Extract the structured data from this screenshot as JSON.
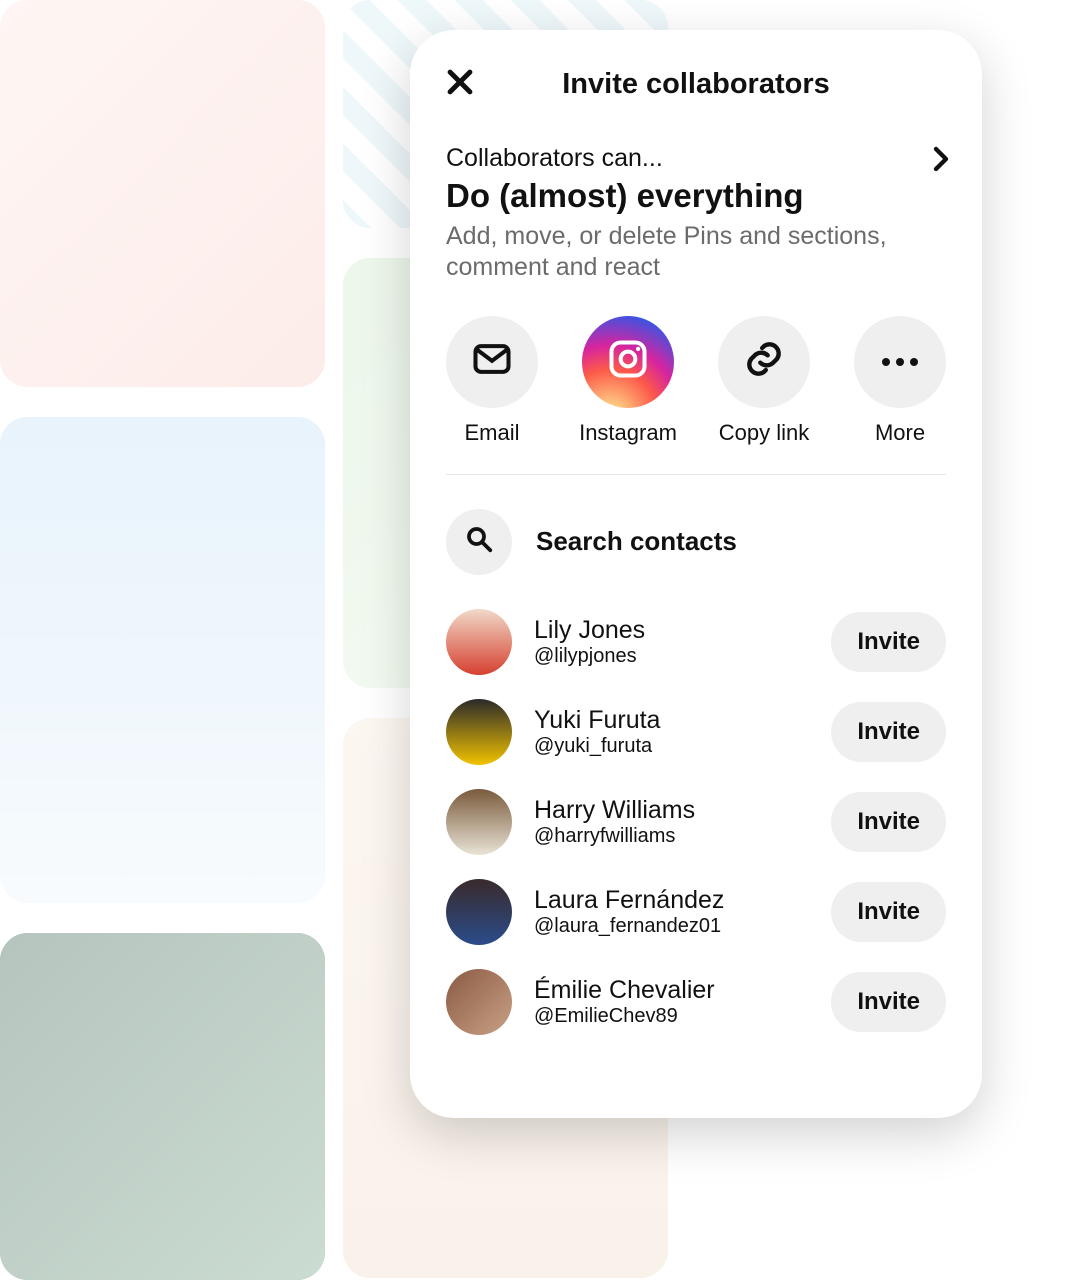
{
  "modal": {
    "title": "Invite collaborators",
    "permission": {
      "caption": "Collaborators can...",
      "title": "Do (almost) everything",
      "description": "Add, move, or delete Pins and sections, comment and react"
    },
    "share_options": [
      {
        "label": "Email"
      },
      {
        "label": "Instagram"
      },
      {
        "label": "Copy link"
      },
      {
        "label": "More"
      }
    ],
    "search_placeholder": "Search contacts",
    "invite_label": "Invite",
    "contacts": [
      {
        "name": "Lily Jones",
        "handle": "@lilypjones"
      },
      {
        "name": "Yuki Furuta",
        "handle": "@yuki_furuta"
      },
      {
        "name": "Harry Williams",
        "handle": "@harryfwilliams"
      },
      {
        "name": "Laura Fernández",
        "handle": "@laura_fernandez01"
      },
      {
        "name": "Émilie Chevalier",
        "handle": "@EmilieChev89"
      }
    ]
  }
}
